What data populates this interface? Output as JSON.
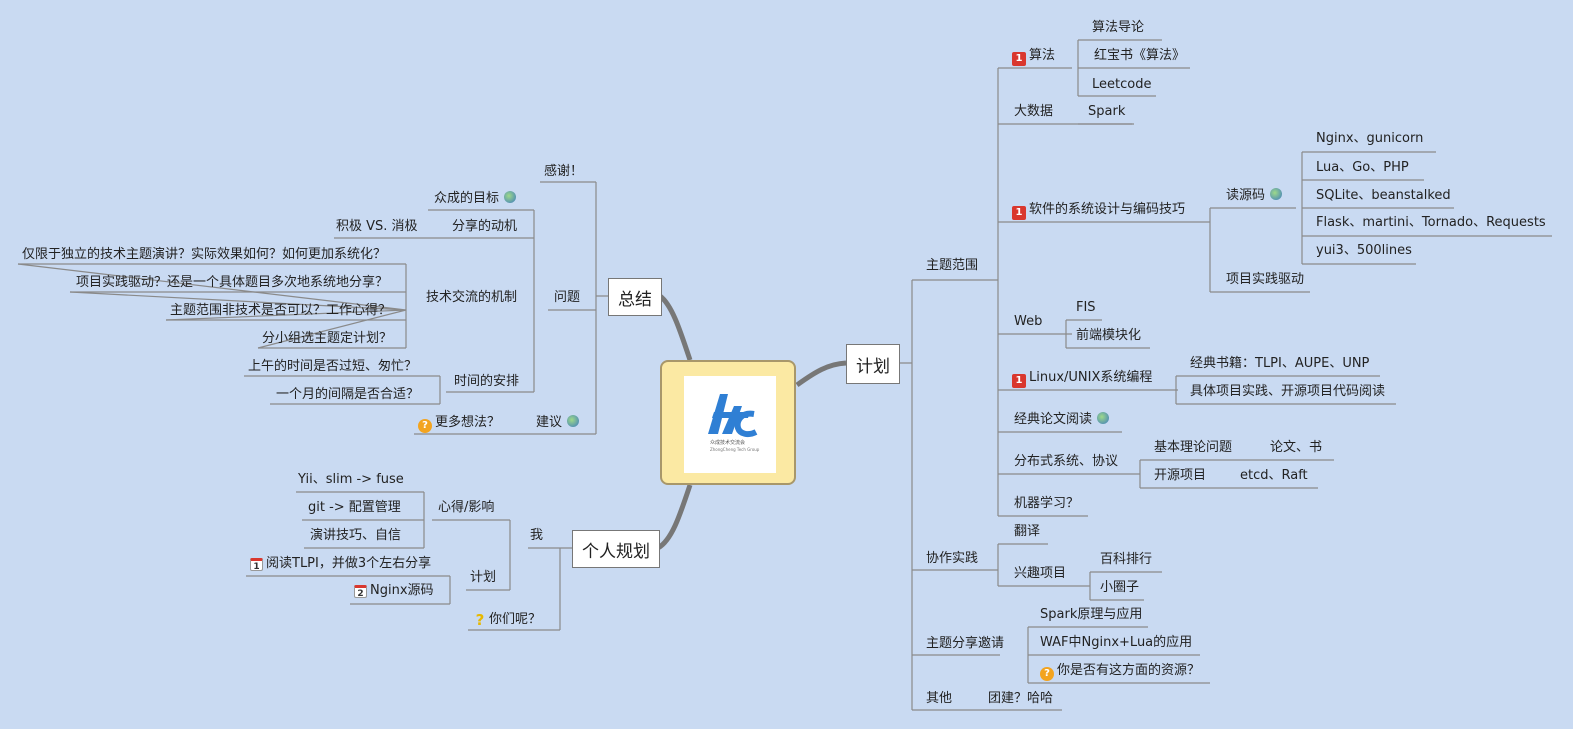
{
  "center": {
    "logo_text": "众成技术交流会",
    "logo_sub": "ZhongCheng Tech Group"
  },
  "branches": {
    "summary": "总结",
    "plan": "计划",
    "personal": "个人规划"
  },
  "right": {
    "topics": "主题范围",
    "algo": "算法",
    "algo_1": "算法导论",
    "algo_2": "红宝书《算法》",
    "algo_3": "Leetcode",
    "bigdata": "大数据",
    "spark": "Spark",
    "design": "软件的系统设计与编码技巧",
    "read_src": "读源码",
    "src_1": "Nginx、gunicorn",
    "src_2": "Lua、Go、PHP",
    "src_3": "SQLite、beanstalked",
    "src_4": "Flask、martini、Tornado、Requests",
    "src_5": "yui3、500lines",
    "proj_drive": "项目实践驱动",
    "web": "Web",
    "fis": "FIS",
    "frontend": "前端模块化",
    "linux": "Linux/UNIX系统编程",
    "linux_1": "经典书籍：TLPI、AUPE、UNP",
    "linux_2": "具体项目实践、开源项目代码阅读",
    "papers": "经典论文阅读",
    "dist": "分布式系统、协议",
    "dist_1": "基本理论问题",
    "dist_1a": "论文、书",
    "dist_2": "开源项目",
    "dist_2a": "etcd、Raft",
    "ml": "机器学习？",
    "collab": "协作实践",
    "translate": "翻译",
    "interest": "兴趣项目",
    "wiki": "百科排行",
    "circle": "小圈子",
    "invite": "主题分享邀请",
    "inv_1": "Spark原理与应用",
    "inv_2": "WAF中Nginx+Lua的应用",
    "inv_3": "你是否有这方面的资源？",
    "other": "其他",
    "team": "团建？哈哈"
  },
  "left": {
    "thanks": "感谢！",
    "goal": "众成的目标",
    "motive": "分享的动机",
    "posneg": "积极 VS. 消极",
    "q1": "仅限于独立的技术主题演讲？实际效果如何？如何更加系统化？",
    "q2": "项目实践驱动？还是一个具体题目多次地系统地分享？",
    "q3": "主题范围非技术是否可以？工作心得？",
    "q4": "分小组选主题定计划？",
    "mechanism": "技术交流的机制",
    "issues": "问题",
    "t1": "上午的时间是否过短、匆忙？",
    "t2": "一个月的间隔是否合适？",
    "time": "时间的安排",
    "more": "更多想法？",
    "suggest": "建议",
    "yii": "Yii、slim -> fuse",
    "git": "git -> 配置管理",
    "speech": "演讲技巧、自信",
    "insight": "心得/影响",
    "me": "我",
    "tlpi": "阅读TLPI，并做3个左右分享",
    "nginx_src": "Nginx源码",
    "schedule": "计划",
    "you": "你们呢？"
  },
  "icons": {
    "badge": "1",
    "cal1": "1",
    "cal2": "2"
  }
}
